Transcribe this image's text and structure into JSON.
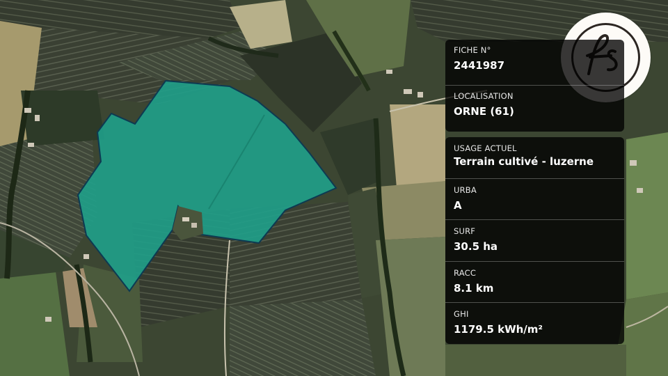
{
  "map": {
    "parcel_color": "#1fa08a",
    "parcel_outline": "#0d3a52"
  },
  "logo": {
    "icon": "fs-monogram-logo",
    "text": "fs"
  },
  "panel_top": {
    "fiche": {
      "label": "FICHE N°",
      "value": "2441987"
    },
    "localisation": {
      "label": "LOCALISATION",
      "value": "ORNE (61)"
    }
  },
  "panel_bottom": {
    "usage": {
      "label": "USAGE ACTUEL",
      "value": "Terrain cultivé - luzerne"
    },
    "urba": {
      "label": "URBA",
      "value": "A"
    },
    "surf": {
      "label": "SURF",
      "value": "30.5 ha"
    },
    "racc": {
      "label": "RACC",
      "value": "8.1 km"
    },
    "ghi": {
      "label": "GHI",
      "value": "1179.5 kWh/m²"
    }
  }
}
